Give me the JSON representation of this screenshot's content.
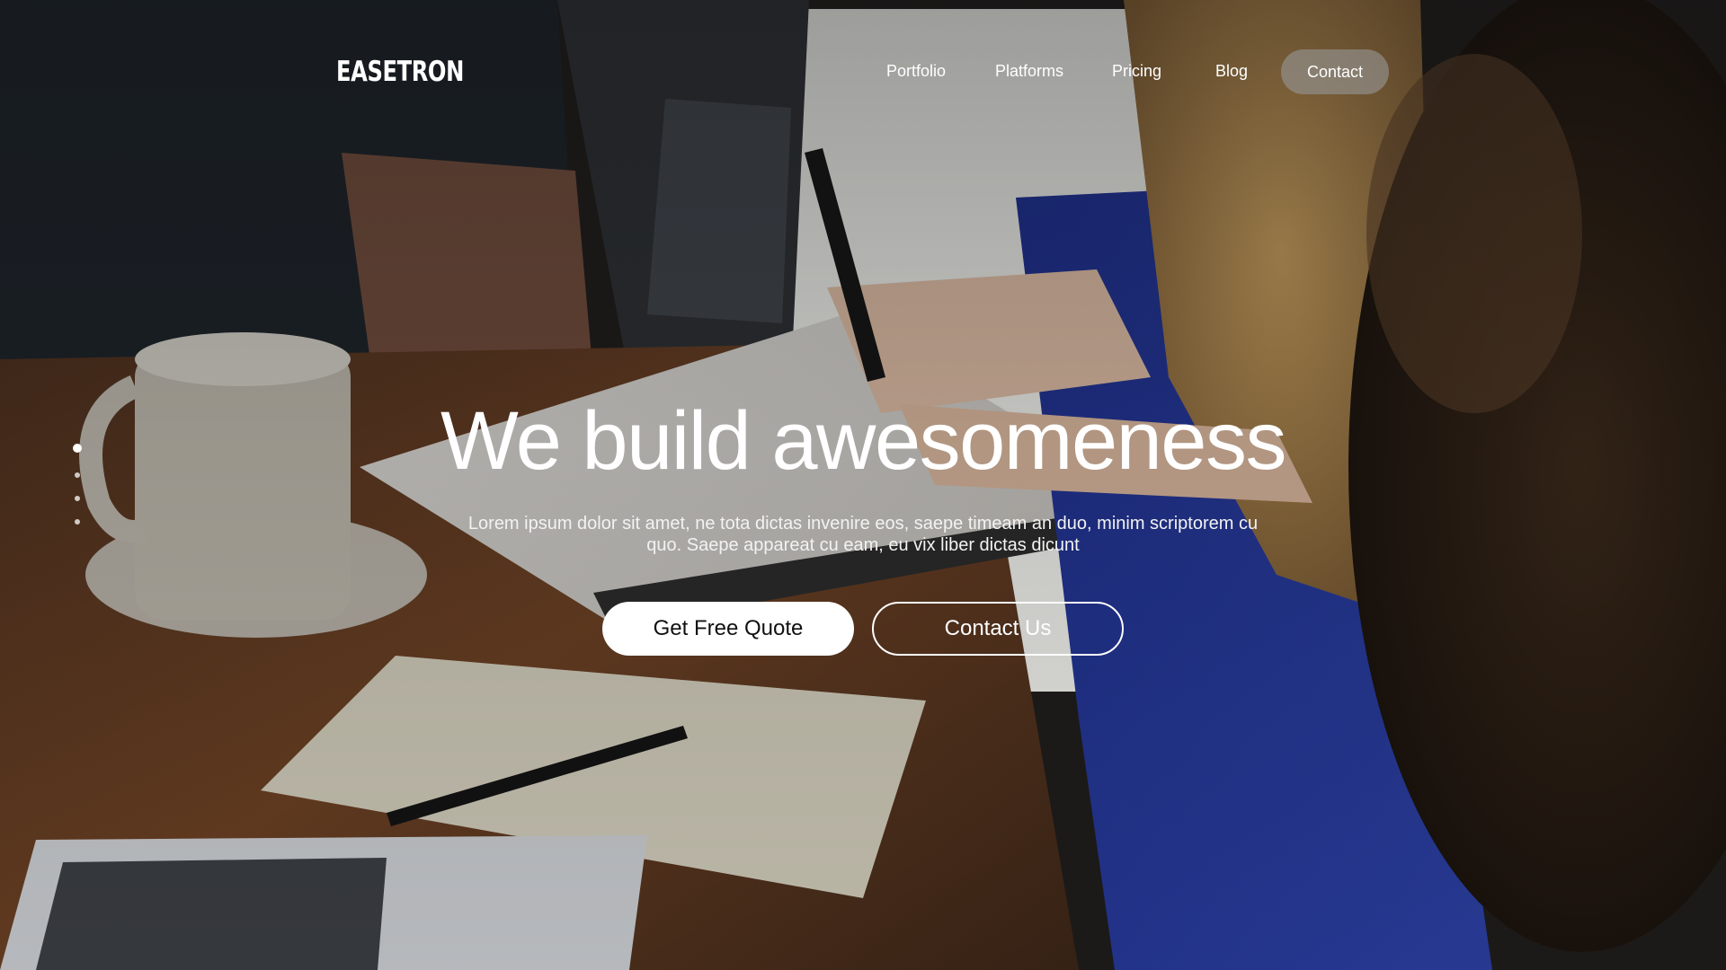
{
  "brand": {
    "logo_text": "EASETRON"
  },
  "nav": {
    "items": [
      {
        "label": "Portfolio"
      },
      {
        "label": "Platforms"
      },
      {
        "label": "Pricing"
      },
      {
        "label": "Blog"
      }
    ],
    "contact_label": "Contact"
  },
  "hero": {
    "headline": "We build awesomeness",
    "subtitle": "Lorem ipsum dolor sit amet, ne tota dictas invenire eos, saepe timeam an duo, minim scriptorem cu quo. Saepe appareat cu eam, eu vix liber dictas dicunt",
    "primary_button": "Get Free Quote",
    "secondary_button": "Contact Us"
  },
  "slider": {
    "total": 4,
    "active": 1
  },
  "colors": {
    "text": "#ffffff",
    "contact_pill": "#969696",
    "primary_button_bg": "#ffffff",
    "primary_button_text": "#111111"
  }
}
